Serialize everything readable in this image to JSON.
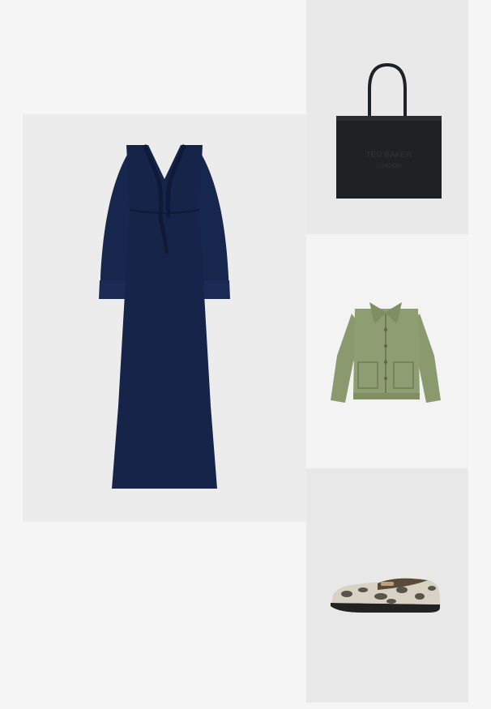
{
  "items": [
    {
      "name": "navy-ruffle-maxi-dress",
      "color": "#16244a"
    },
    {
      "name": "black-tote-bag",
      "color": "#1f2224",
      "embossed_text": [
        "TED BAKER",
        "LONDON"
      ]
    },
    {
      "name": "khaki-shirt-jacket",
      "color": "#8b9a6e"
    },
    {
      "name": "snakeskin-loafer",
      "color": "#d8d2c4"
    }
  ]
}
